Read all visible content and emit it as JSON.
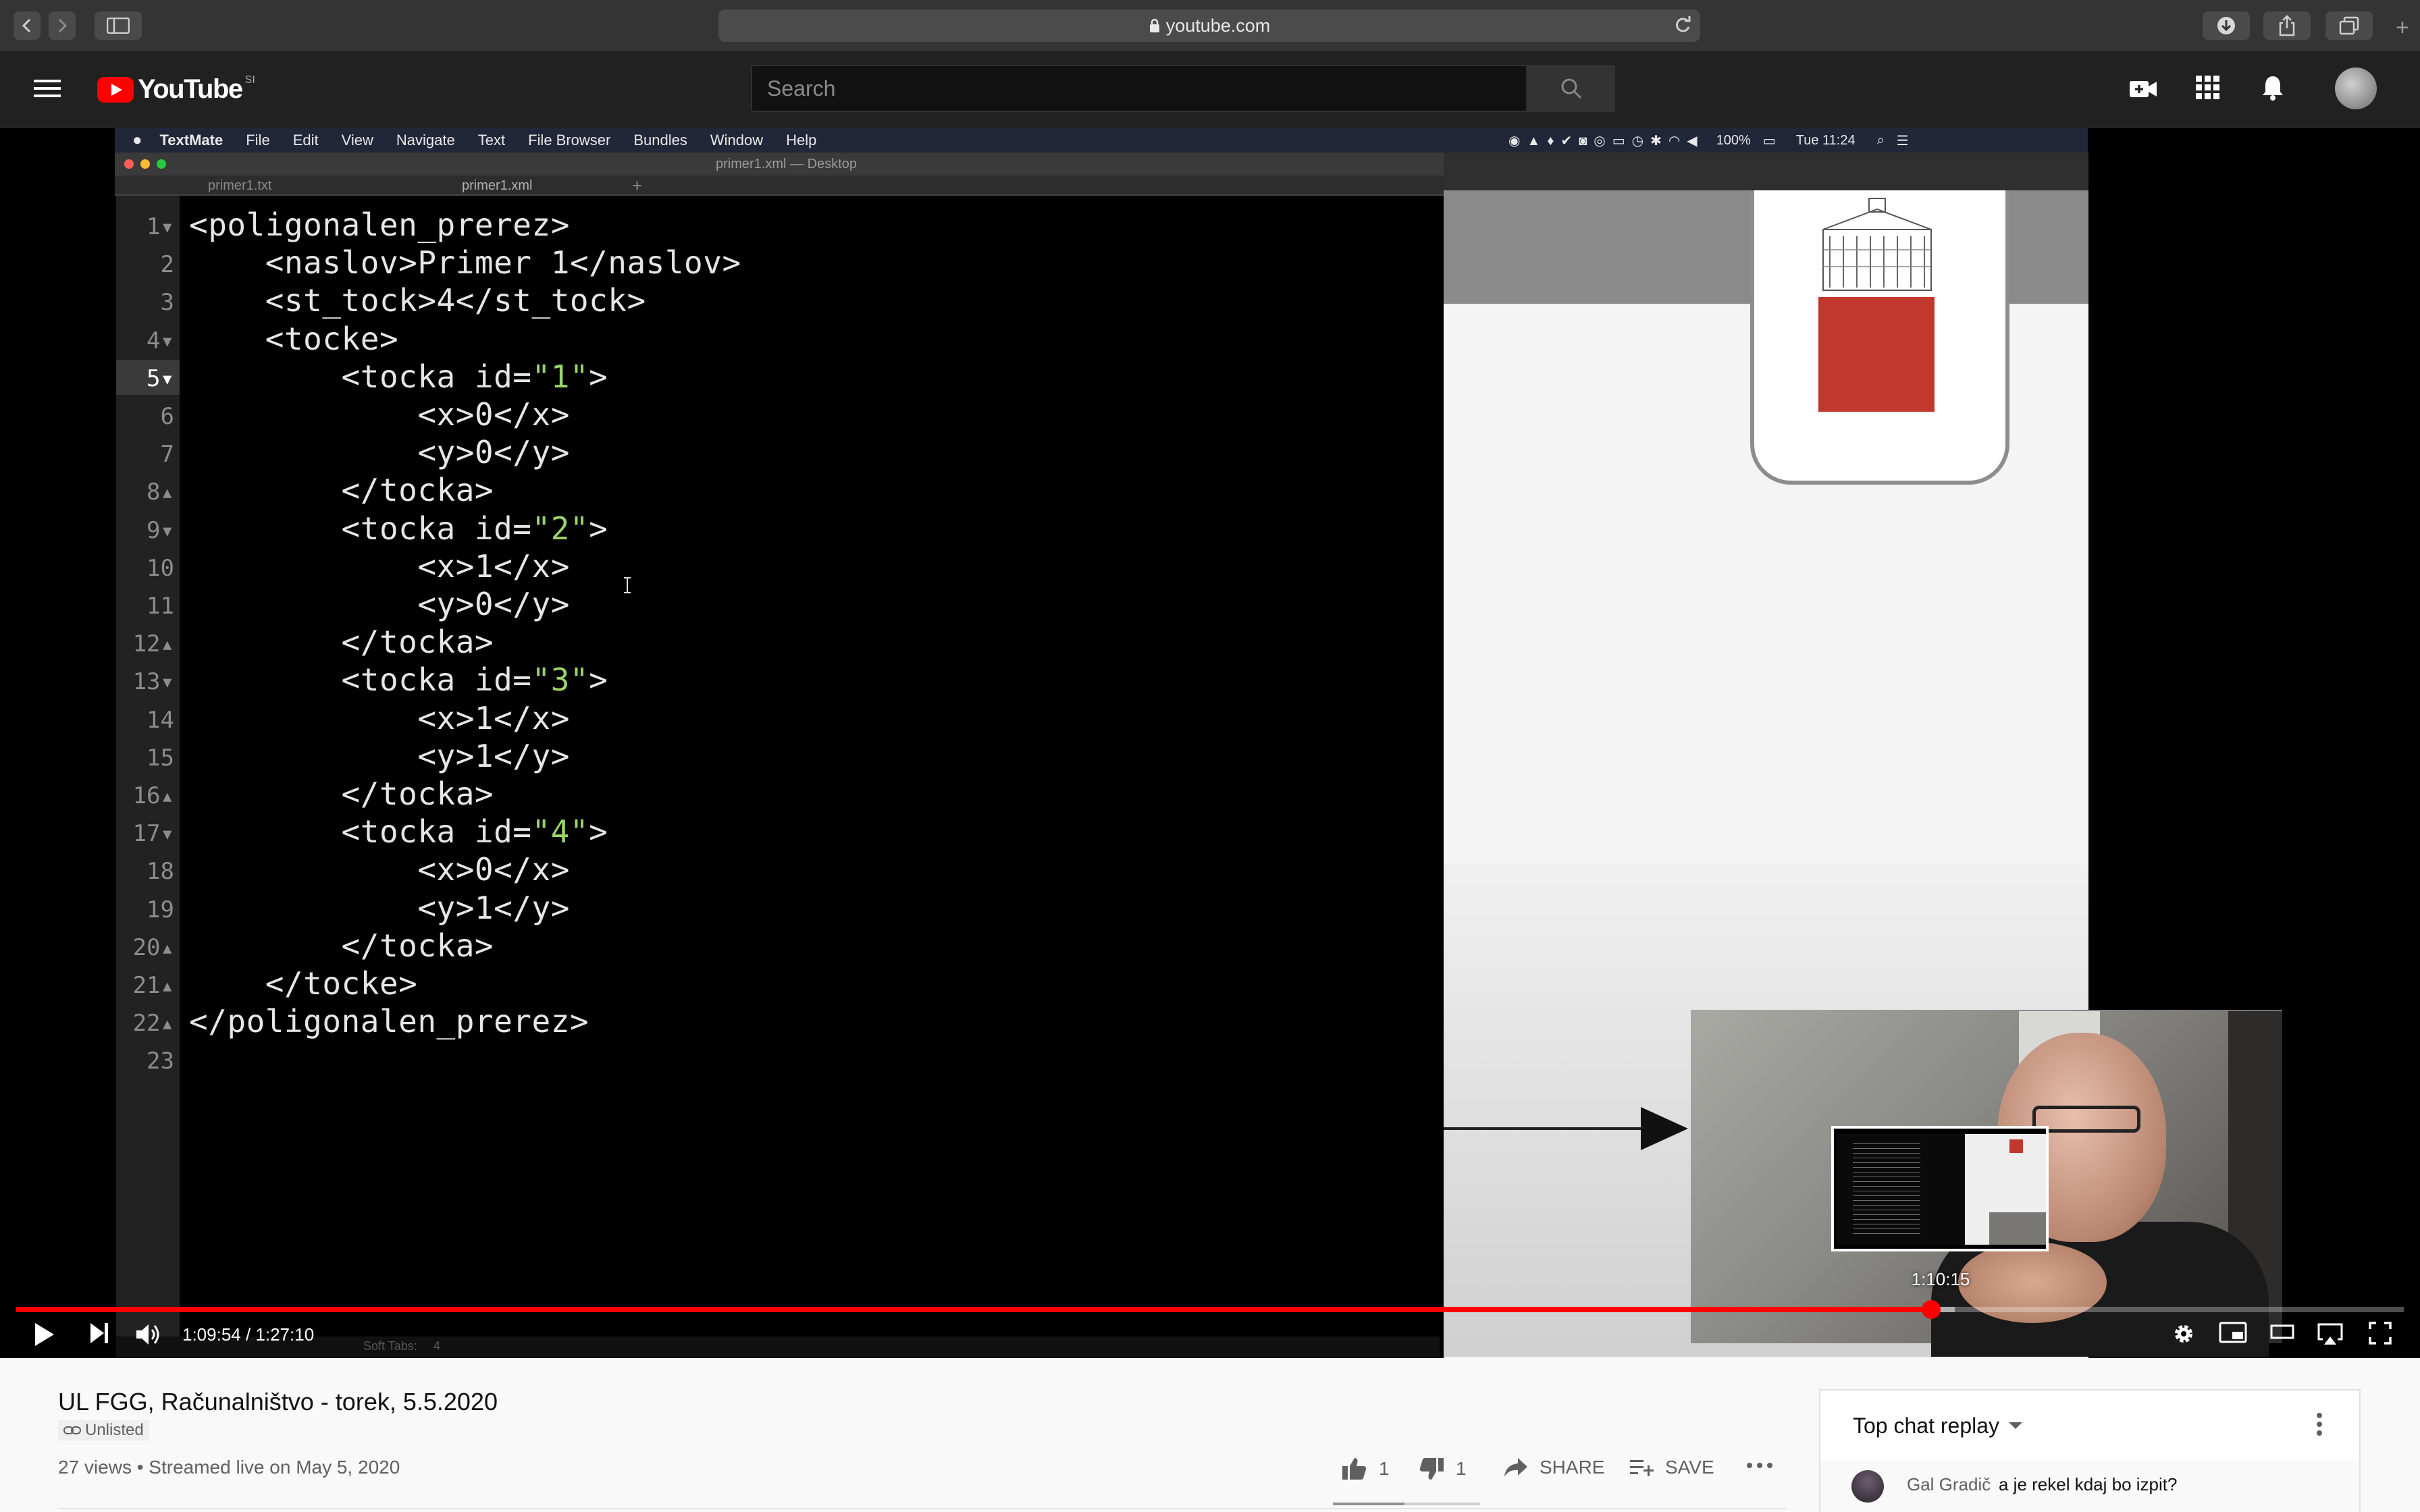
{
  "browser": {
    "url": "youtube.com"
  },
  "youtube": {
    "logo_text": "YouTube",
    "region": "SI",
    "search_placeholder": "Search"
  },
  "video_frame": {
    "mac_menu": [
      "TextMate",
      "File",
      "Edit",
      "View",
      "Navigate",
      "Text",
      "File Browser",
      "Bundles",
      "Window",
      "Help"
    ],
    "mac_status": {
      "battery": "100%",
      "clock": "Tue 11:24"
    },
    "editor_title": "primer1.xml — Desktop",
    "editor_tabs": [
      "primer1.txt",
      "primer1.xml"
    ],
    "status_bar": {
      "soft_tabs": "Soft Tabs:",
      "tab_size": "4"
    },
    "code_lines": [
      {
        "n": "1▾",
        "text": "<poligonalen_prerez>"
      },
      {
        "n": "2",
        "text": "    <naslov>Primer 1</naslov>"
      },
      {
        "n": "3",
        "text": "    <st_tock>4</st_tock>"
      },
      {
        "n": "4▾",
        "text": "    <tocke>"
      },
      {
        "n": "5▾",
        "text": "        <tocka id=\"1\">",
        "cur": true
      },
      {
        "n": "6",
        "text": "            <x>0</x>"
      },
      {
        "n": "7",
        "text": "            <y>0</y>"
      },
      {
        "n": "8▴",
        "text": "        </tocka>"
      },
      {
        "n": "9▾",
        "text": "        <tocka id=\"2\">"
      },
      {
        "n": "10",
        "text": "            <x>1</x>"
      },
      {
        "n": "11",
        "text": "            <y>0</y>"
      },
      {
        "n": "12▴",
        "text": "        </tocka>"
      },
      {
        "n": "13▾",
        "text": "        <tocka id=\"3\">"
      },
      {
        "n": "14",
        "text": "            <x>1</x>"
      },
      {
        "n": "15",
        "text": "            <y>1</y>"
      },
      {
        "n": "16▴",
        "text": "        </tocka>"
      },
      {
        "n": "17▾",
        "text": "        <tocka id=\"4\">"
      },
      {
        "n": "18",
        "text": "            <x>0</x>"
      },
      {
        "n": "19",
        "text": "            <y>1</y>"
      },
      {
        "n": "20▴",
        "text": "        </tocka>"
      },
      {
        "n": "21▴",
        "text": "    </tocke>"
      },
      {
        "n": "22▴",
        "text": "</poligonalen_prerez>"
      },
      {
        "n": "23",
        "text": ""
      }
    ]
  },
  "player": {
    "time_display": "1:09:54 / 1:27:10",
    "hover_time": "1:10:15",
    "progress_fraction": 0.802,
    "loaded_fraction": 0.812
  },
  "video_info": {
    "title": "UL FGG, Računalništvo - torek, 5.5.2020",
    "visibility": "Unlisted",
    "views_and_date": "27 views • Streamed live on May 5, 2020",
    "likes": "1",
    "dislikes": "1",
    "share_label": "SHARE",
    "save_label": "SAVE"
  },
  "chat": {
    "header": "Top chat replay",
    "messages": [
      {
        "author": "Gal Gradič",
        "text": "a je rekel kdaj bo izpit?"
      }
    ]
  },
  "colors": {
    "accent_red": "#ff0000",
    "string_green": "#9bd36a",
    "logo_red": "#c1392d"
  }
}
